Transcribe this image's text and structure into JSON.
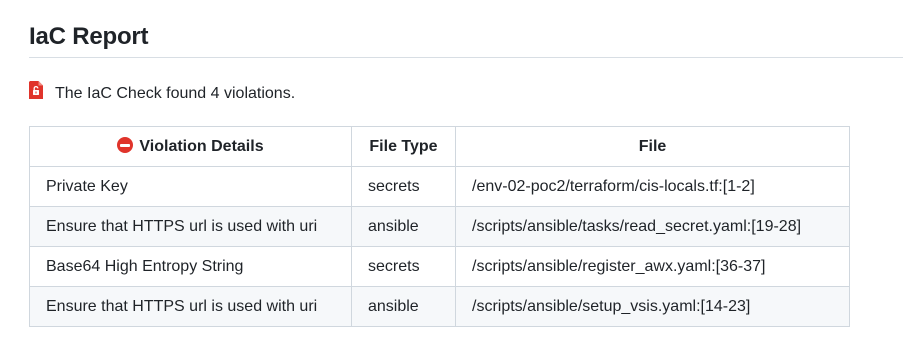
{
  "report": {
    "title": "IaC Report",
    "summary": "The IaC Check found 4 violations.",
    "summary_icon": "locked-file-icon",
    "accent_color": "#e0342b"
  },
  "table": {
    "headers": {
      "details_icon": "no-entry-icon",
      "details": "Violation Details",
      "file_type": "File Type",
      "file": "File"
    },
    "rows": [
      {
        "details": "Private Key",
        "file_type": "secrets",
        "file": "/env-02-poc2/terraform/cis-locals.tf:[1-2]"
      },
      {
        "details": "Ensure that HTTPS url is used with uri",
        "file_type": "ansible",
        "file": "/scripts/ansible/tasks/read_secret.yaml:[19-28]"
      },
      {
        "details": "Base64 High Entropy String",
        "file_type": "secrets",
        "file": "/scripts/ansible/register_awx.yaml:[36-37]"
      },
      {
        "details": "Ensure that HTTPS url is used with uri",
        "file_type": "ansible",
        "file": "/scripts/ansible/setup_vsis.yaml:[14-23]"
      }
    ]
  }
}
